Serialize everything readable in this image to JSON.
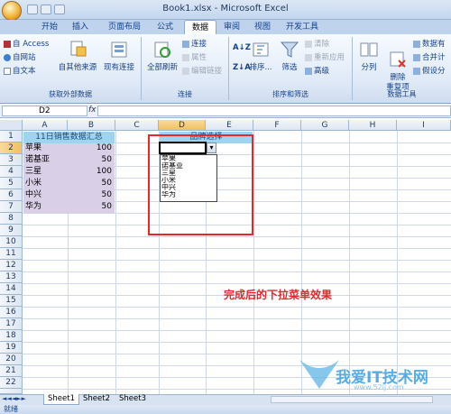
{
  "window": {
    "title": "Book1.xlsx - Microsoft Excel"
  },
  "tabs": [
    {
      "label": "开始",
      "active": false
    },
    {
      "label": "插入",
      "active": false
    },
    {
      "label": "页面布局",
      "active": false
    },
    {
      "label": "公式",
      "active": false
    },
    {
      "label": "数据",
      "active": true
    },
    {
      "label": "审阅",
      "active": false
    },
    {
      "label": "视图",
      "active": false
    },
    {
      "label": "开发工具",
      "active": false
    }
  ],
  "ribbon": {
    "external": {
      "access": "自 Access",
      "web": "自网站",
      "text": "自文本",
      "other": "自其他来源",
      "existing": "现有连接",
      "label": "获取外部数据"
    },
    "connections": {
      "refresh": "全部刷新",
      "connections": "连接",
      "properties": "属性",
      "edit_links": "编辑链接",
      "label": "连接"
    },
    "sort_filter": {
      "az": "A↓Z",
      "za": "Z↓A",
      "sort": "排序...",
      "filter": "筛选",
      "clear": "清除",
      "reapply": "重新应用",
      "advanced": "高级",
      "label": "排序和筛选"
    },
    "tools": {
      "split": "分列",
      "remove_dup": "删除\n重复项",
      "validation": "数据有",
      "consolidate": "合并计",
      "whatif": "假设分",
      "label": "数据工具"
    }
  },
  "formula_bar": {
    "cell_ref": "D2",
    "fx": "fx",
    "value": ""
  },
  "columns": [
    "A",
    "B",
    "C",
    "D",
    "E",
    "F",
    "G",
    "H",
    "I"
  ],
  "rows": [
    "1",
    "2",
    "3",
    "4",
    "5",
    "6",
    "7",
    "8",
    "9",
    "10",
    "11",
    "12",
    "13",
    "14",
    "15",
    "16",
    "17",
    "18",
    "19",
    "20",
    "21",
    "22",
    "23"
  ],
  "sheet": {
    "header": "11日销售数据汇总",
    "d1_label": "品牌选择",
    "data": [
      {
        "brand": "苹果",
        "value": "100"
      },
      {
        "brand": "诺基亚",
        "value": "50"
      },
      {
        "brand": "三星",
        "value": "100"
      },
      {
        "brand": "小米",
        "value": "50"
      },
      {
        "brand": "中兴",
        "value": "50"
      },
      {
        "brand": "华为",
        "value": "50"
      }
    ]
  },
  "dropdown": {
    "options": [
      "苹果",
      "诺基亚",
      "三星",
      "小米",
      "中兴",
      "华为"
    ]
  },
  "annotation": "完成后的下拉菜单效果",
  "watermark": {
    "text": "我爱IT技术网",
    "url": "www.52ij.com"
  },
  "sheet_tabs": [
    "Sheet1",
    "Sheet2",
    "Sheet3"
  ],
  "status": "就绪",
  "colors": {
    "header_fill": "#9fd4f0",
    "data_fill": "#d9cfe6",
    "highlight_border": "#e8262b",
    "annotation": "#e8262b"
  }
}
